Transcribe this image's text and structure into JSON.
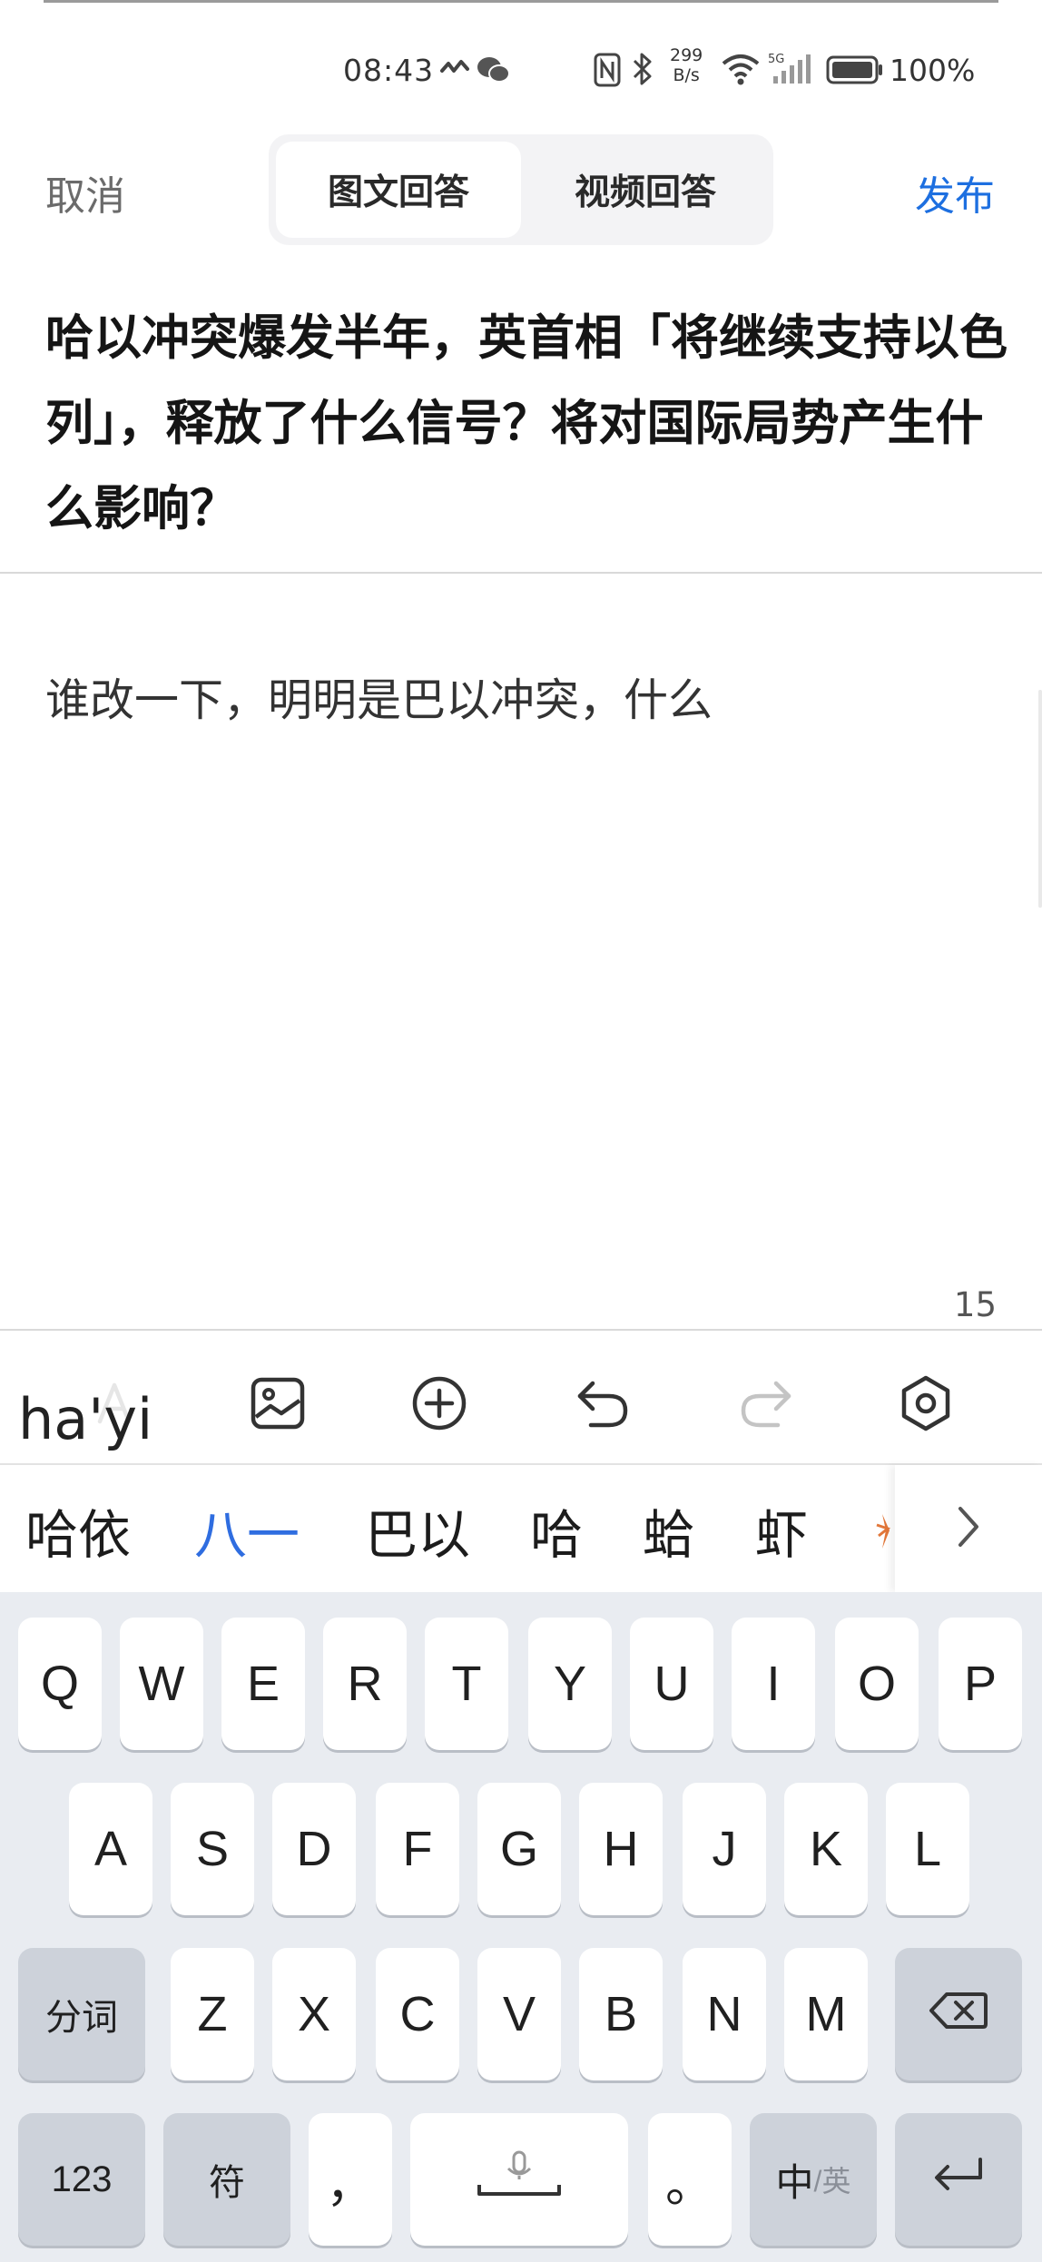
{
  "status_bar": {
    "time": "08:43",
    "speed_value": "299",
    "speed_unit": "B/s",
    "battery_pct": "100%"
  },
  "header": {
    "cancel_label": "取消",
    "tab_text_answer": "图文回答",
    "tab_video_answer": "视频回答",
    "publish_label": "发布"
  },
  "question": {
    "text": "哈以冲突爆发半年，英首相「将继续支持以色列」，释放了什么信号？将对国际局势产生什么影响？"
  },
  "editor": {
    "answer_text": "谁改一下，明明是巴以冲突，什么",
    "char_count": "15"
  },
  "toolbar": {
    "icons": [
      "text-format-icon",
      "image-icon",
      "add-circle-icon",
      "undo-icon",
      "redo-icon",
      "settings-icon"
    ]
  },
  "ime": {
    "composing": "ha'yi",
    "candidates": [
      "哈依",
      "八一",
      "巴以",
      "哈",
      "蛤",
      "虾"
    ],
    "highlighted_index": 1
  },
  "keyboard": {
    "row1": [
      "Q",
      "W",
      "E",
      "R",
      "T",
      "Y",
      "U",
      "I",
      "O",
      "P"
    ],
    "row2": [
      "A",
      "S",
      "D",
      "F",
      "G",
      "H",
      "J",
      "K",
      "L"
    ],
    "row3": [
      "Z",
      "X",
      "C",
      "V",
      "B",
      "N",
      "M"
    ],
    "segment_key": "分词",
    "numbers_key": "123",
    "symbols_key": "符",
    "comma_key": "，",
    "period_key": "。",
    "lang_key_main": "中",
    "lang_key_alt": "/英"
  },
  "colors": {
    "accent": "#1d6fe0",
    "candidate_highlight": "#2f6de0",
    "keyboard_bg": "#e9ecf1",
    "function_key_bg": "#cdd2da"
  }
}
